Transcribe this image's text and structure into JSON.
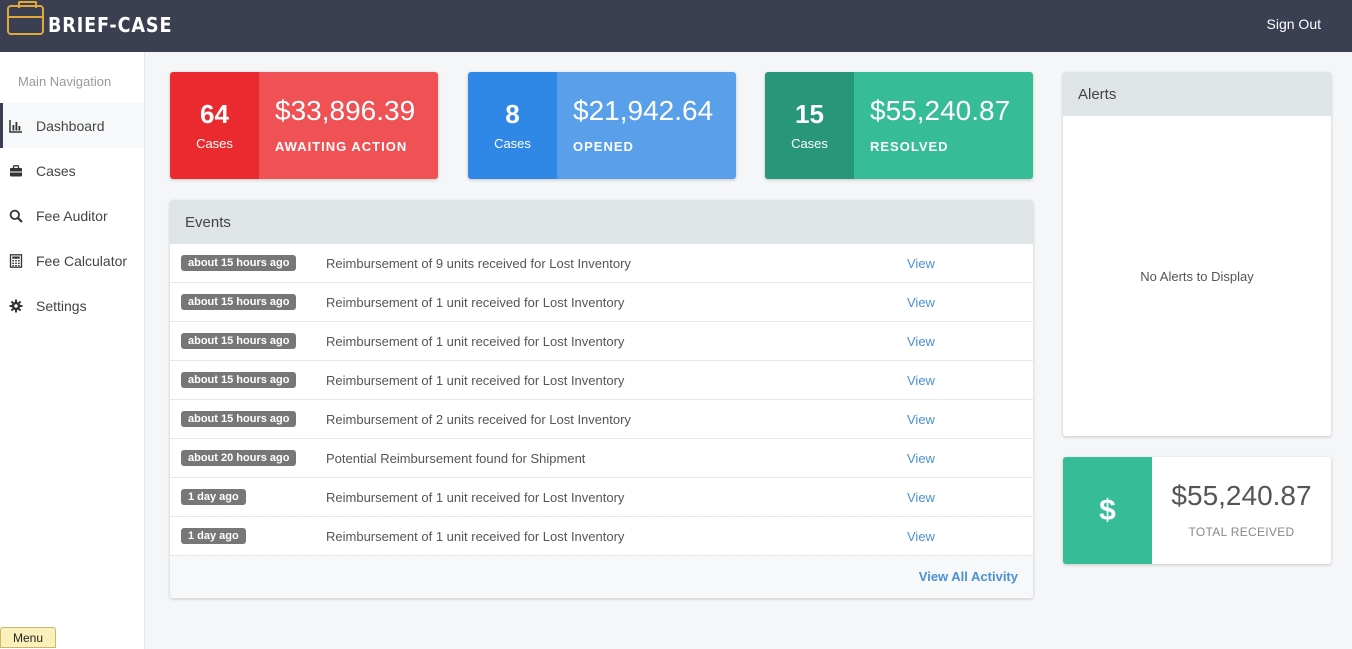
{
  "header": {
    "brand": "BRIEF-CASE",
    "signout_label": "Sign Out"
  },
  "sidebar": {
    "heading": "Main Navigation",
    "items": [
      {
        "label": "Dashboard",
        "icon": "bar-chart-icon",
        "active": true
      },
      {
        "label": "Cases",
        "icon": "briefcase-icon"
      },
      {
        "label": "Fee Auditor",
        "icon": "search-icon"
      },
      {
        "label": "Fee Calculator",
        "icon": "calculator-icon"
      },
      {
        "label": "Settings",
        "icon": "gear-icon"
      }
    ],
    "menu_label": "Menu"
  },
  "stats": [
    {
      "count": "64",
      "unit": "Cases",
      "amount": "$33,896.39",
      "label": "AWAITING ACTION",
      "color": "#ea2a2f"
    },
    {
      "count": "8",
      "unit": "Cases",
      "amount": "$21,942.64",
      "label": "OPENED",
      "color": "#3088e6"
    },
    {
      "count": "15",
      "unit": "Cases",
      "amount": "$55,240.87",
      "label": "RESOLVED",
      "color": "#279679"
    }
  ],
  "events": {
    "title": "Events",
    "rows": [
      {
        "time": "about 15 hours ago",
        "text": "Reimbursement of 9 units received for Lost Inventory",
        "link": "View"
      },
      {
        "time": "about 15 hours ago",
        "text": "Reimbursement of 1 unit received for Lost Inventory",
        "link": "View"
      },
      {
        "time": "about 15 hours ago",
        "text": "Reimbursement of 1 unit received for Lost Inventory",
        "link": "View"
      },
      {
        "time": "about 15 hours ago",
        "text": "Reimbursement of 1 unit received for Lost Inventory",
        "link": "View"
      },
      {
        "time": "about 15 hours ago",
        "text": "Reimbursement of 2 units received for Lost Inventory",
        "link": "View"
      },
      {
        "time": "about 20 hours ago",
        "text": "Potential Reimbursement found for Shipment",
        "link": "View"
      },
      {
        "time": "1 day ago",
        "text": "Reimbursement of 1 unit received for Lost Inventory",
        "link": "View"
      },
      {
        "time": "1 day ago",
        "text": "Reimbursement of 1 unit received for Lost Inventory",
        "link": "View"
      }
    ],
    "view_all": "View All Activity"
  },
  "alerts": {
    "title": "Alerts",
    "empty_text": "No Alerts to Display"
  },
  "total": {
    "symbol": "$",
    "amount": "$55,240.87",
    "label": "TOTAL RECEIVED",
    "color": "#36bc97"
  }
}
